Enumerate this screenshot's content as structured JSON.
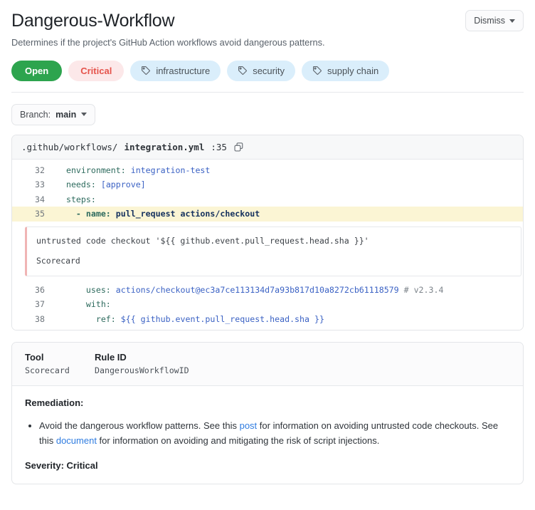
{
  "header": {
    "title": "Dangerous-Workflow",
    "description": "Determines if the project's GitHub Action workflows avoid dangerous patterns.",
    "dismiss_label": "Dismiss",
    "dismiss_icon": "chevron-down-icon"
  },
  "badges": [
    {
      "label": "Open",
      "type": "status",
      "color": "#2da44e",
      "text_color": "#ffffff",
      "icon": null
    },
    {
      "label": "Critical",
      "type": "severity",
      "color": "#fce8e9",
      "text_color": "#e5534b",
      "icon": null
    },
    {
      "label": "infrastructure",
      "type": "tag",
      "color": "#daeefb",
      "text_color": "#4b5258",
      "icon": "tag-icon"
    },
    {
      "label": "security",
      "type": "tag",
      "color": "#daeefb",
      "text_color": "#4b5258",
      "icon": "tag-icon"
    },
    {
      "label": "supply chain",
      "type": "tag",
      "color": "#daeefb",
      "text_color": "#4b5258",
      "icon": "tag-icon"
    }
  ],
  "branch": {
    "prefix": "Branch: ",
    "name": "main",
    "icon": "chevron-down-icon"
  },
  "code": {
    "path_prefix": ".github/workflows/",
    "file_name": "integration.yml",
    "line_suffix": ":35",
    "copy_icon": "copy-icon",
    "lines": [
      {
        "number": "32",
        "highlight": false,
        "indent": "  ",
        "key": "environment:",
        "value": " integration-test"
      },
      {
        "number": "33",
        "highlight": false,
        "indent": "  ",
        "key": "needs:",
        "value": " [approve]"
      },
      {
        "number": "34",
        "highlight": false,
        "indent": "  ",
        "key": "steps:",
        "value": ""
      },
      {
        "number": "35",
        "highlight": true,
        "indent": "    ",
        "key": "- name:",
        "value": " pull_request actions/checkout"
      }
    ],
    "lines_after": [
      {
        "number": "36",
        "highlight": false,
        "indent": "      ",
        "key": "uses:",
        "value": " actions/checkout@ec3a7ce113134d7a93b817d10a8272cb61118579",
        "comment": " # v2.3.4"
      },
      {
        "number": "37",
        "highlight": false,
        "indent": "      ",
        "key": "with:",
        "value": "",
        "comment": ""
      },
      {
        "number": "38",
        "highlight": false,
        "indent": "        ",
        "key": "ref:",
        "value": " ${{ github.event.pull_request.head.sha }}",
        "comment": ""
      }
    ]
  },
  "annotation": {
    "message": "untrusted code checkout '${{ github.event.pull_request.head.sha }}'",
    "tool": "Scorecard"
  },
  "details": {
    "tool_header": "Tool",
    "tool_value": "Scorecard",
    "rule_header": "Rule ID",
    "rule_value": "DangerousWorkflowID",
    "remediation_title": "Remediation:",
    "remediation_items": [
      {
        "part1": "Avoid the dangerous workflow patterns. See this ",
        "link1": "post",
        "part2": " for information on avoiding untrusted code checkouts. See this ",
        "link2": "document",
        "part3": " for information on avoiding and mitigating the risk of script injections."
      }
    ],
    "severity_label": "Severity:",
    "severity_value": "Critical"
  }
}
